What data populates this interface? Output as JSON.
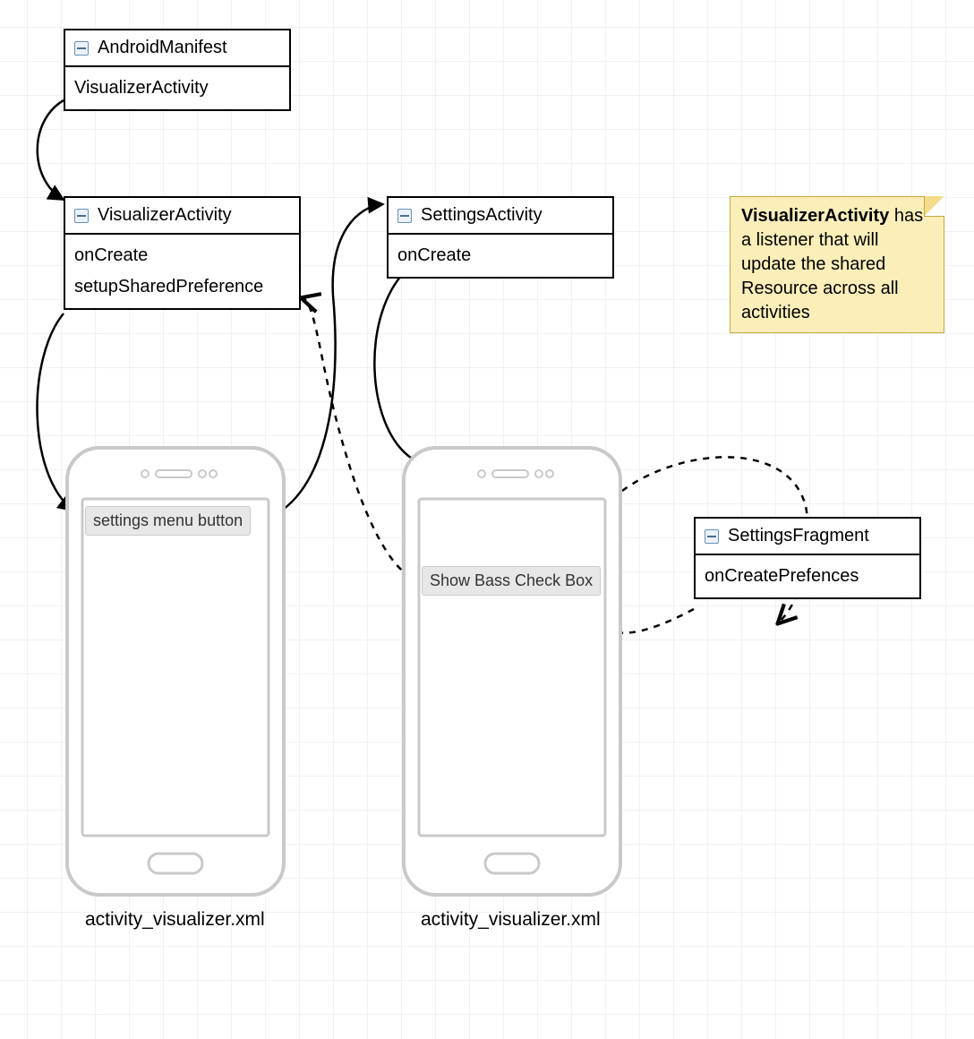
{
  "boxes": {
    "manifest": {
      "title": "AndroidManifest",
      "row1": "VisualizerActivity"
    },
    "visualizer": {
      "title": "VisualizerActivity",
      "row1": "onCreate",
      "row2": "setupSharedPreference"
    },
    "settingsActivity": {
      "title": "SettingsActivity",
      "row1": "onCreate"
    },
    "settingsFragment": {
      "title": "SettingsFragment",
      "row1": "onCreatePrefences"
    }
  },
  "note": {
    "bold": "VisualizerActivity",
    "rest": " has a listener that will update the shared Resource across all activities"
  },
  "phones": {
    "left": {
      "button": "settings menu button",
      "caption": "activity_visualizer.xml"
    },
    "right": {
      "button": "Show Bass Check Box",
      "caption": "activity_visualizer.xml"
    }
  }
}
